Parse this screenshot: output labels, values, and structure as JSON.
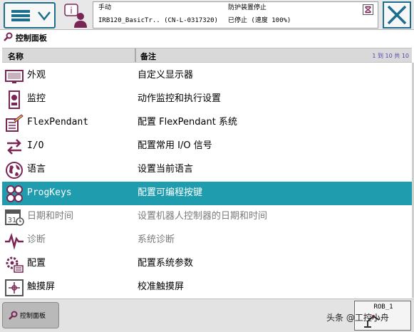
{
  "topbar": {
    "mode_label": "手动",
    "controller_label": "IRB120_BasicTr..  (CN-L-0317320)",
    "safety_label": "防护装置停止",
    "run_state_label": "已停止 (速度 100%)"
  },
  "panel": {
    "title": "控制面板"
  },
  "table": {
    "col_name": "名称",
    "col_desc": "备注",
    "count": "1 到 10 共 10",
    "rows": [
      {
        "name": "外观",
        "desc": "自定义显示器",
        "icon": "monitor-icon"
      },
      {
        "name": "监控",
        "desc": "动作监控和执行设置",
        "icon": "supervision-icon"
      },
      {
        "name": "FlexPendant",
        "desc": "配置 FlexPendant 系统",
        "icon": "flexpendant-icon"
      },
      {
        "name": "I/O",
        "desc": "配置常用 I/O 信号",
        "icon": "io-arrows-icon"
      },
      {
        "name": "语言",
        "desc": "设置当前语言",
        "icon": "globe-icon"
      },
      {
        "name": "ProgKeys",
        "desc": "配置可编程按键",
        "icon": "progkeys-icon"
      },
      {
        "name": "日期和时间",
        "desc": "设置机器人控制器的日期和时间",
        "icon": "calendar-icon"
      },
      {
        "name": "诊断",
        "desc": "系统诊断",
        "icon": "diagnostics-icon"
      },
      {
        "name": "配置",
        "desc": "配置系统参数",
        "icon": "configuration-icon"
      },
      {
        "name": "触摸屏",
        "desc": "校准触摸屏",
        "icon": "touchscreen-icon"
      }
    ],
    "selected_index": 5
  },
  "bottombar": {
    "task_label": "控制面板",
    "rob_label": "ROB_1",
    "watermark": "头条 @工控小舟"
  },
  "colors": {
    "accent": "#1c6f8c",
    "selected_row": "#1f9cad",
    "icon_purple": "#7a2655"
  }
}
